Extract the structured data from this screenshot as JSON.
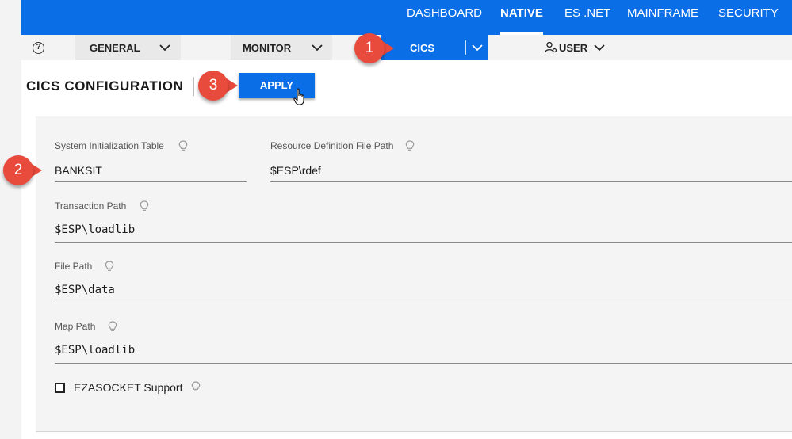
{
  "topnav": {
    "items": [
      {
        "label": "DASHBOARD",
        "active": false
      },
      {
        "label": "NATIVE",
        "active": true
      },
      {
        "label": "ES .NET",
        "active": false
      },
      {
        "label": "MAINFRAME",
        "active": false
      },
      {
        "label": "SECURITY",
        "active": false
      }
    ]
  },
  "subnav": {
    "help_icon": "?",
    "menus": [
      {
        "label": "GENERAL",
        "active": false
      },
      {
        "label": "MONITOR",
        "active": false
      },
      {
        "label": "CICS",
        "active": true
      },
      {
        "label": "USER",
        "active": false
      }
    ]
  },
  "page": {
    "title": "CICS CONFIGURATION",
    "apply_label": "APPLY"
  },
  "form": {
    "sit": {
      "label": "System Initialization Table",
      "value": "BANKSIT"
    },
    "rdef": {
      "label": "Resource Definition File Path",
      "value": "$ESP\\rdef"
    },
    "transaction": {
      "label": "Transaction Path",
      "value": "$ESP\\loadlib"
    },
    "file": {
      "label": "File Path",
      "value": "$ESP\\data"
    },
    "map": {
      "label": "Map Path",
      "value": "$ESP\\loadlib"
    },
    "ezasocket": {
      "label": "EZASOCKET Support",
      "checked": false
    }
  },
  "callouts": [
    "1",
    "2",
    "3"
  ],
  "colors": {
    "primary": "#0a6ee6",
    "callout": "#e84a3c",
    "panel": "#f4f4f4"
  }
}
